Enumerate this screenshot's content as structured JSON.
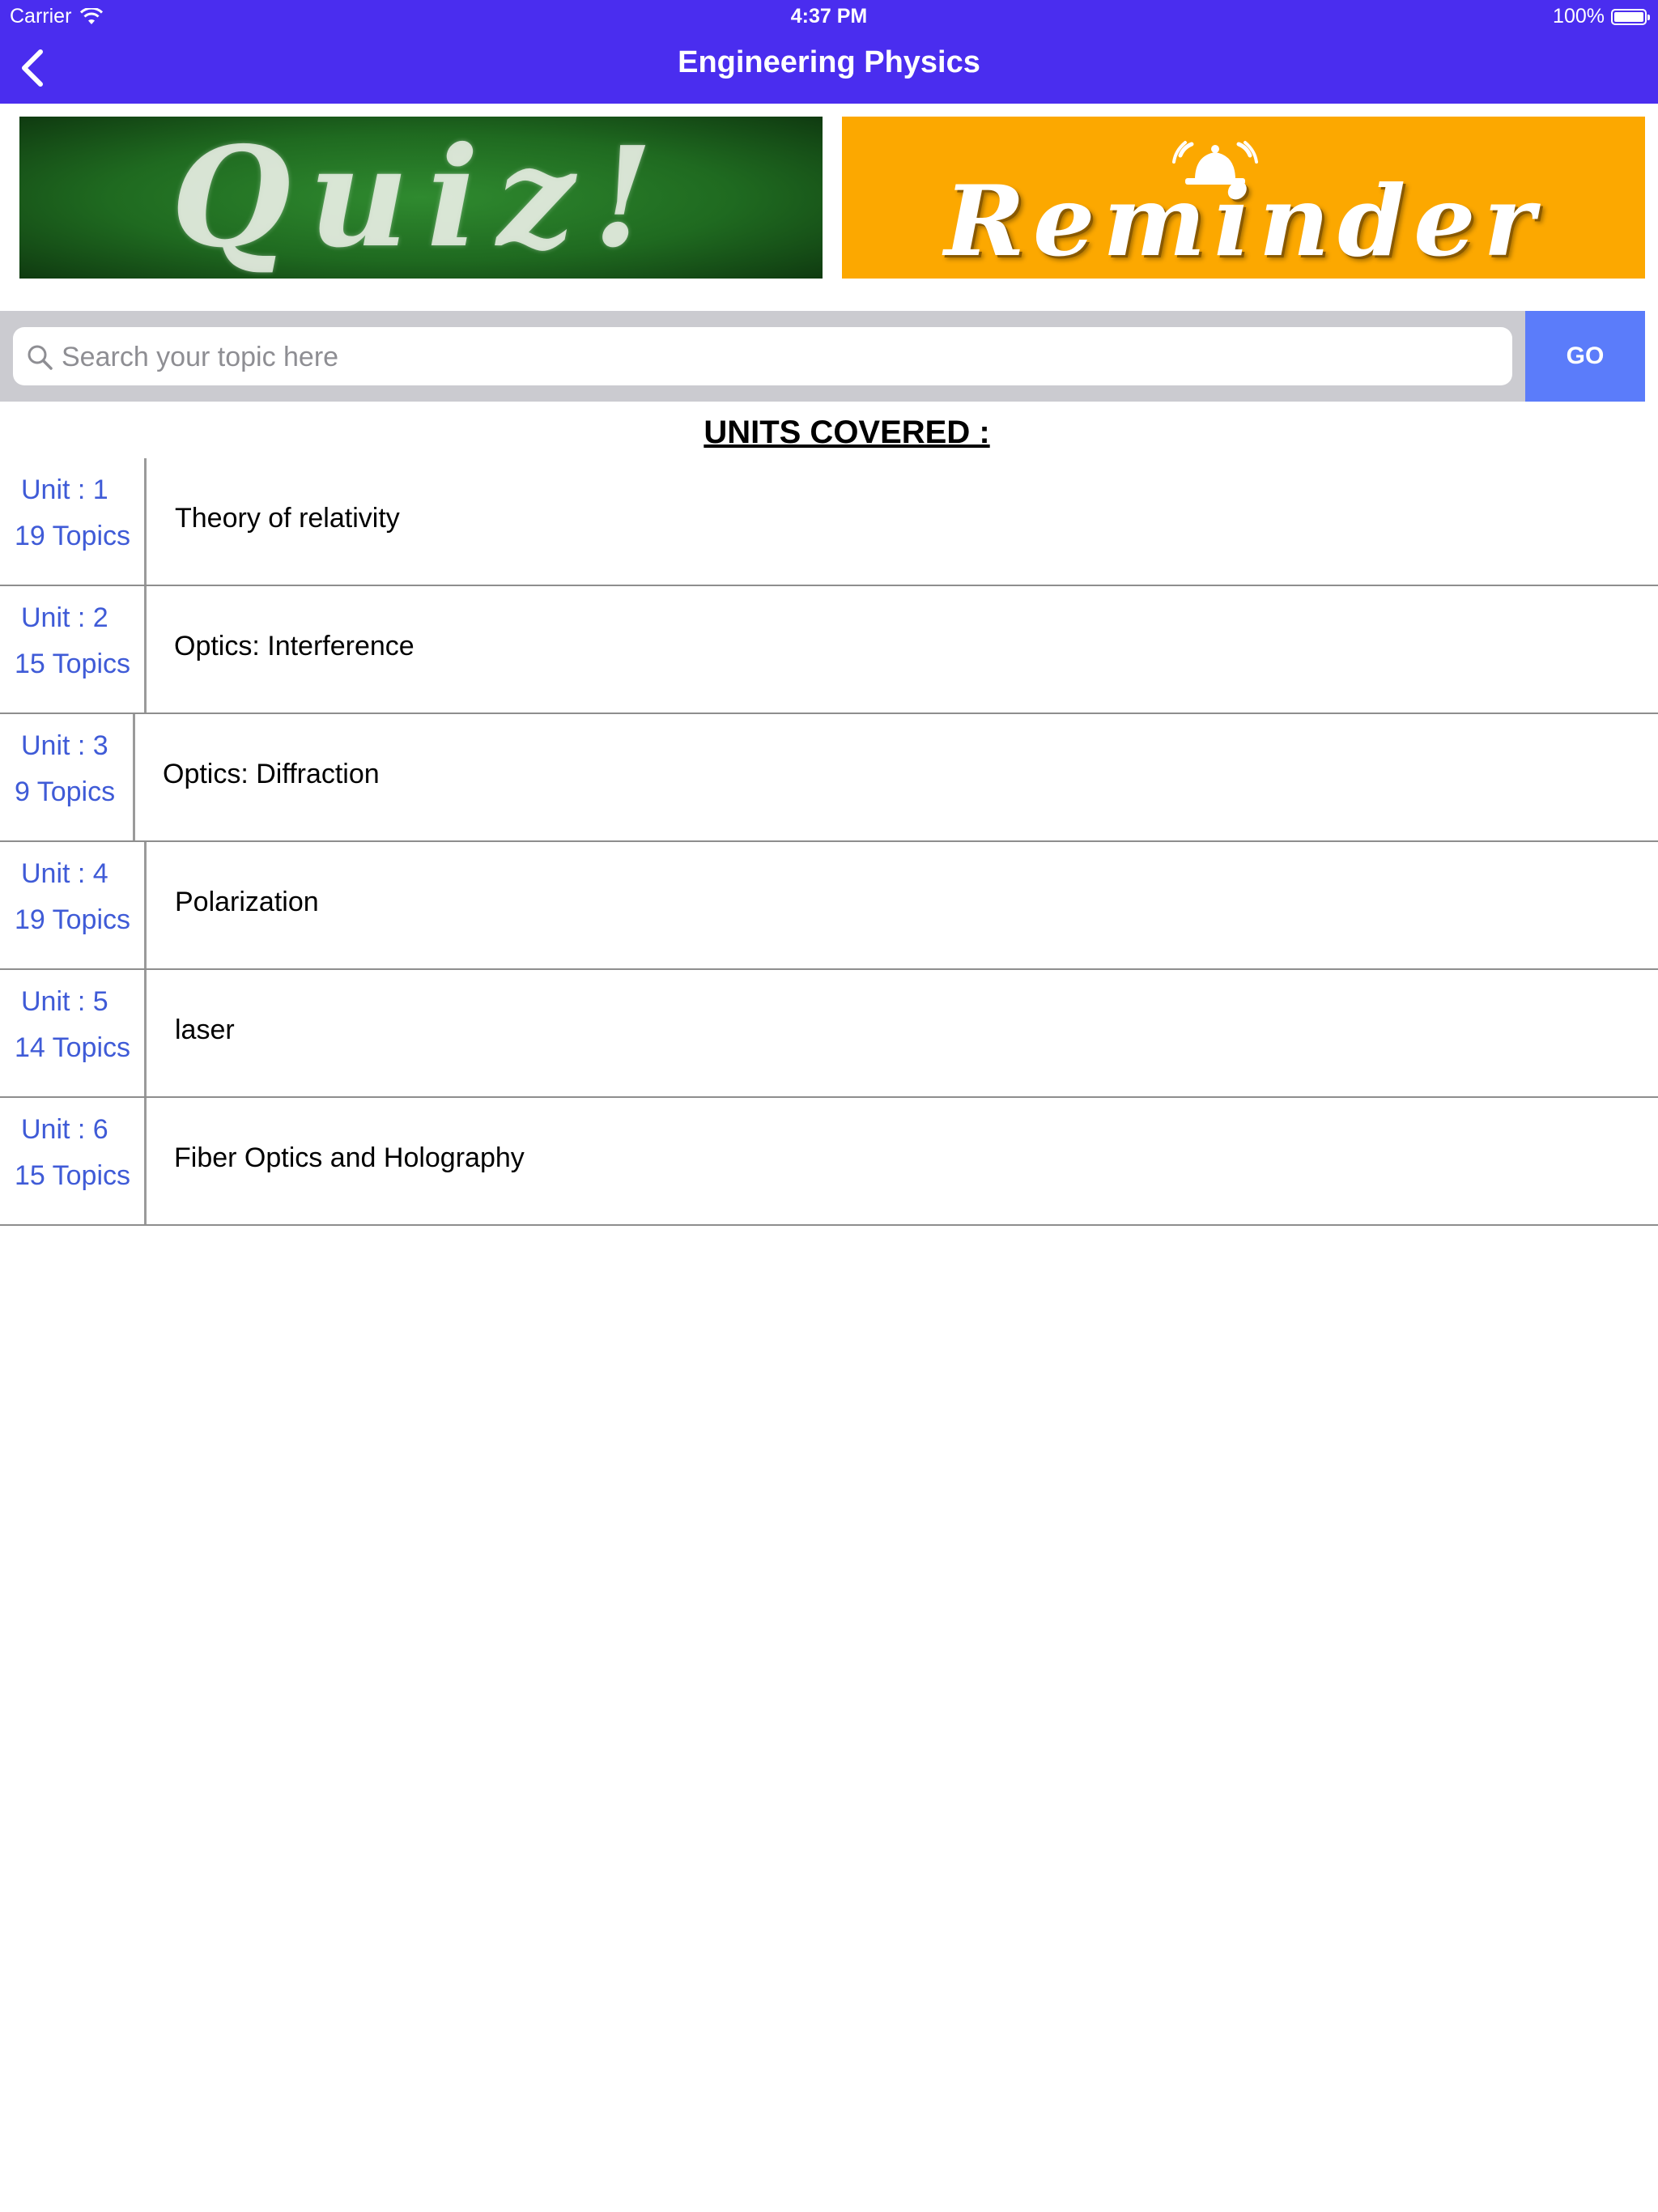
{
  "status_bar": {
    "carrier": "Carrier",
    "time": "4:37 PM",
    "battery": "100%"
  },
  "nav": {
    "title": "Engineering Physics",
    "back_icon": "chevron-left-icon"
  },
  "banners": {
    "quiz": "Quiz!",
    "reminder": "Reminder"
  },
  "search": {
    "placeholder": "Search your topic here",
    "value": "",
    "go_label": "GO"
  },
  "units_heading": "UNITS COVERED :",
  "units": [
    {
      "unit": "Unit : 1",
      "topics": "19 Topics",
      "name": "Theory of relativity"
    },
    {
      "unit": "Unit : 2",
      "topics": "15 Topics",
      "name": "Optics: Interference"
    },
    {
      "unit": "Unit : 3",
      "topics": "9 Topics",
      "name": "Optics: Diffraction"
    },
    {
      "unit": "Unit : 4",
      "topics": "19 Topics",
      "name": "Polarization"
    },
    {
      "unit": "Unit : 5",
      "topics": "14 Topics",
      "name": "laser"
    },
    {
      "unit": "Unit : 6",
      "topics": "15 Topics",
      "name": "Fiber Optics and Holography"
    }
  ],
  "colors": {
    "header": "#4a2def",
    "go_button": "#5b7cfa",
    "link_blue": "#3f5bd7",
    "reminder_bg": "#fca800"
  }
}
